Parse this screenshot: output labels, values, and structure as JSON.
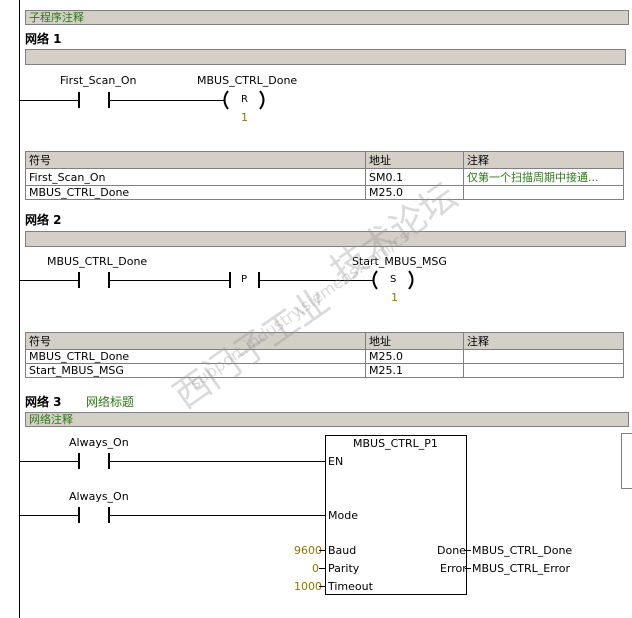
{
  "sub_comment": "子程序注释",
  "network1": {
    "title": "网络 1",
    "contact_label": "First_Scan_On",
    "coil_label": "MBUS_CTRL_Done",
    "coil_type": "R",
    "coil_count": "1",
    "table": {
      "headers": [
        "符号",
        "地址",
        "注释"
      ],
      "rows": [
        [
          "First_Scan_On",
          "SM0.1",
          "仅第一个扫描周期中接通..."
        ],
        [
          "MBUS_CTRL_Done",
          "M25.0",
          ""
        ]
      ]
    }
  },
  "network2": {
    "title": "网络 2",
    "contact_label": "MBUS_CTRL_Done",
    "p_label": "P",
    "coil_label": "Start_MBUS_MSG",
    "coil_type": "S",
    "coil_count": "1",
    "table": {
      "headers": [
        "符号",
        "地址",
        "注释"
      ],
      "rows": [
        [
          "MBUS_CTRL_Done",
          "M25.0",
          ""
        ],
        [
          "Start_MBUS_MSG",
          "M25.1",
          ""
        ]
      ]
    }
  },
  "network3": {
    "title": "网络 3",
    "subtitle": "网络标题",
    "comment": "网络注释",
    "contact1_label": "Always_On",
    "contact2_label": "Always_On",
    "block": {
      "name": "MBUS_CTRL_P1",
      "en": "EN",
      "mode": "Mode",
      "baud": "Baud",
      "parity": "Parity",
      "timeout": "Timeout",
      "done": "Done",
      "error": "Error"
    },
    "baud_value": "9600",
    "parity_value": "0",
    "timeout_value": "1000",
    "done_output": "MBUS_CTRL_Done",
    "error_output": "MBUS_CTRL_Error"
  },
  "watermark": {
    "main": "西门子工业",
    "sub": "support.industry.siemens.com/cs",
    "main2": "技术论坛"
  }
}
